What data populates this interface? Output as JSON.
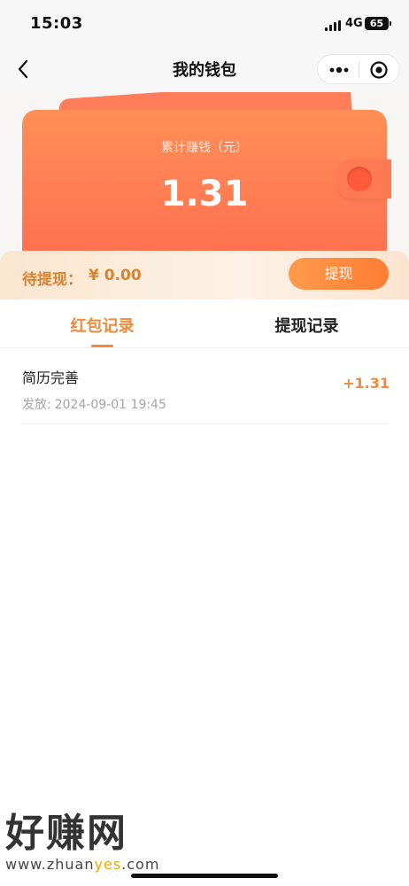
{
  "status_bar": {
    "time": "15:03",
    "network": "4G",
    "battery": "65"
  },
  "nav": {
    "title": "我的钱包",
    "back_icon": "chevron-left-icon",
    "more_icon": "more-dots-icon",
    "close_icon": "target-circle-icon"
  },
  "wallet": {
    "total_label": "累计赚钱（元）",
    "total_amount": "1.31",
    "pending_label": "待提现：",
    "pending_amount": "¥ 0.00",
    "withdraw_button": "提现"
  },
  "tabs": [
    {
      "label": "红包记录",
      "active": true
    },
    {
      "label": "提现记录",
      "active": false
    }
  ],
  "records": [
    {
      "title": "简历完善",
      "time_label": "发放:",
      "time": "2024-09-01 19:45",
      "amount": "+1.31"
    }
  ],
  "watermark": {
    "text": "好赚网",
    "url_prefix": "www.zhuan",
    "url_highlight": "yes",
    "url_suffix": ".com"
  },
  "colors": {
    "accent": "#f08a3c",
    "card_top": "#ff8f57",
    "card_bottom": "#ff6a4f",
    "pending_text": "#d9822f"
  }
}
